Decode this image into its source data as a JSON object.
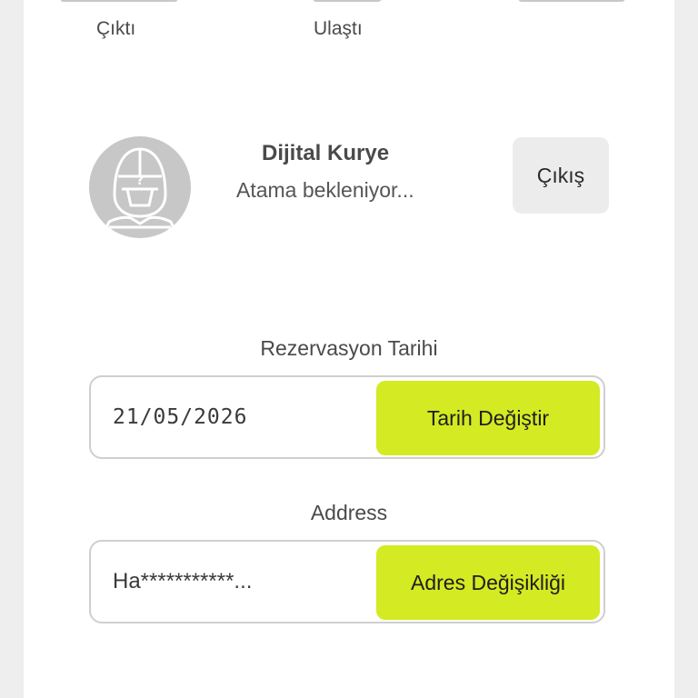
{
  "status_steps": [
    {
      "label": "Çıktı"
    },
    {
      "label": "Ulaştı"
    },
    {
      "label": ""
    }
  ],
  "courier": {
    "name": "Dijital Kurye",
    "status": "Atama bekleniyor...",
    "exit_label": "Çıkış"
  },
  "reservation": {
    "label": "Rezervasyon Tarihi",
    "value": "21/05/2026",
    "button_label": "Tarih Değiştir"
  },
  "address": {
    "label": "Address",
    "value": "Ha***********...",
    "button_label": "Adres Değişikliği"
  },
  "colors": {
    "accent": "#d4ea22",
    "avatar": "#c7c7c7",
    "background": "#eeeeee",
    "card": "#ffffff"
  },
  "icons": {
    "avatar": "courier-helmet-icon"
  }
}
